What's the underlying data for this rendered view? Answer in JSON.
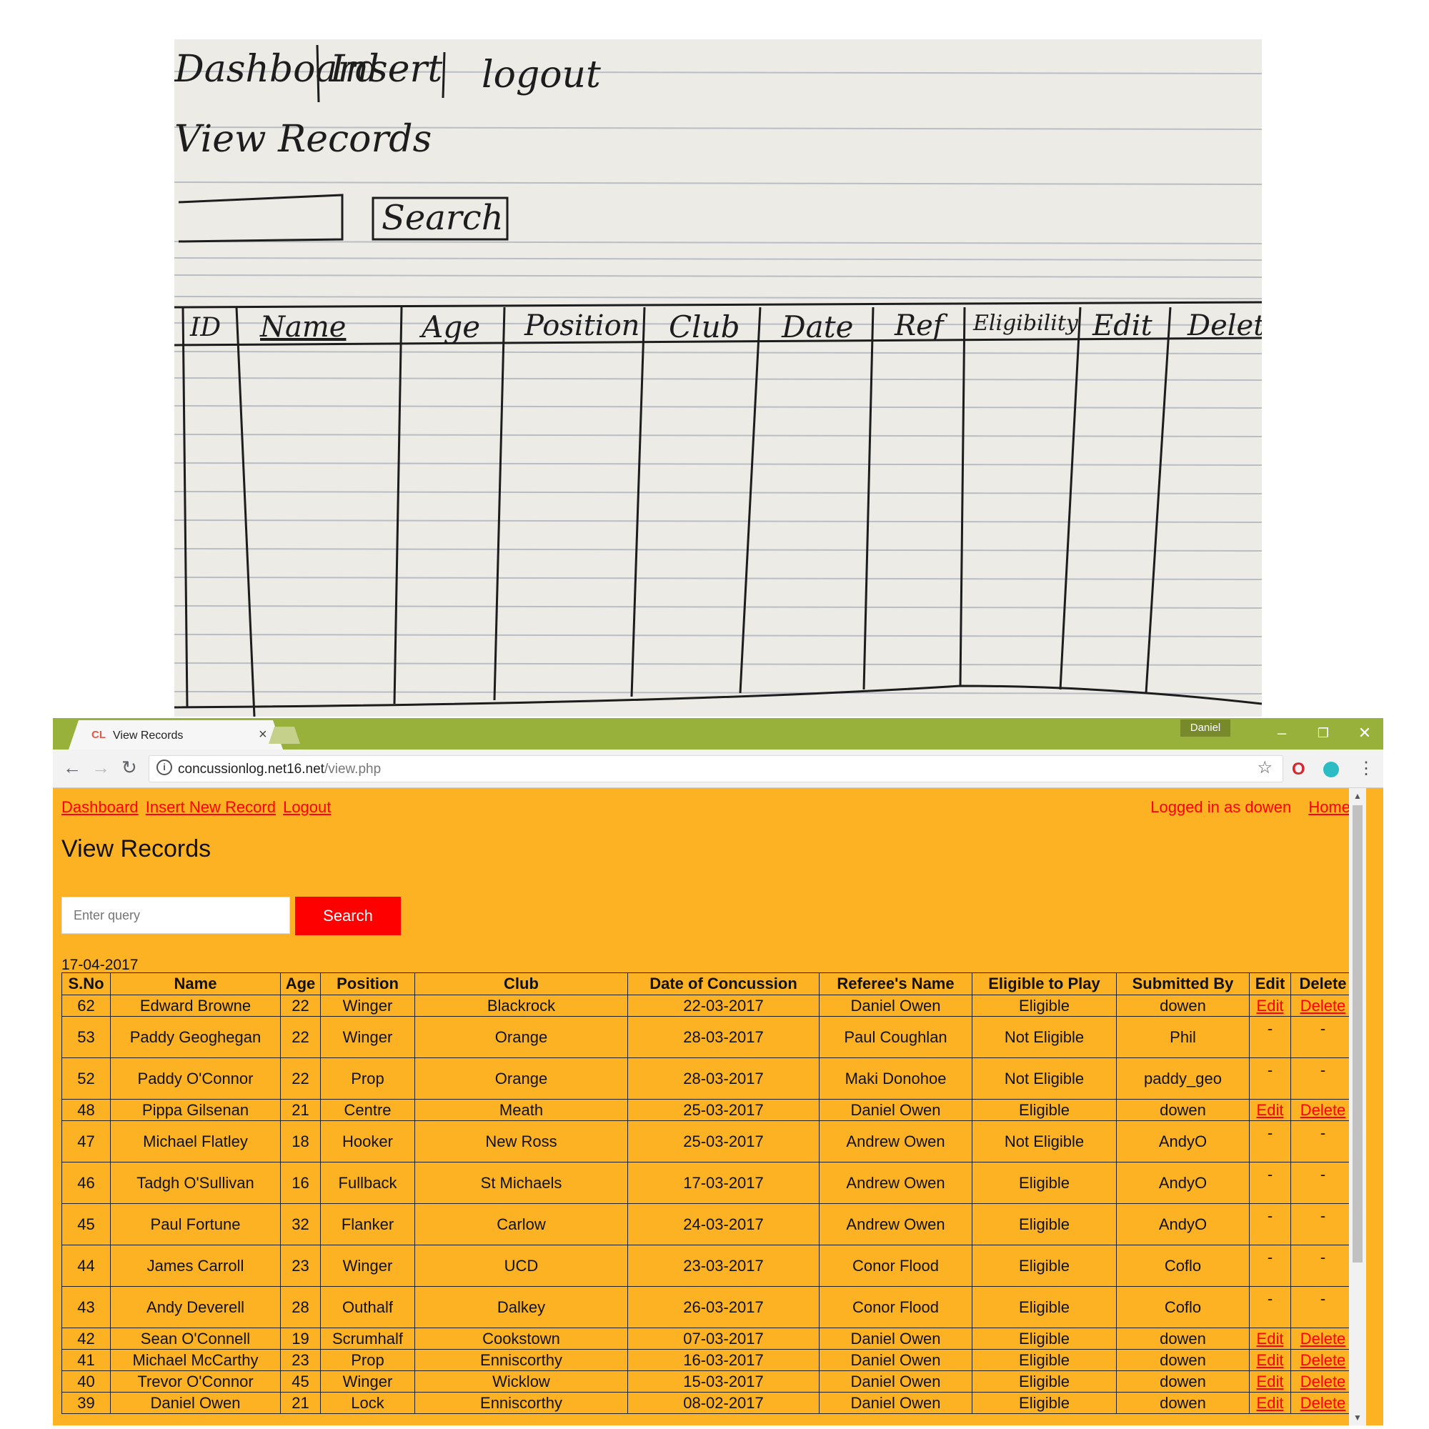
{
  "sketch": {
    "nav": [
      "Dashboard",
      "Insert",
      "logout"
    ],
    "title": "View Records",
    "search_label": "Search",
    "columns": [
      "ID",
      "Name",
      "Age",
      "Position",
      "Club",
      "Date",
      "Ref",
      "Eligibility",
      "Edit",
      "Delete"
    ]
  },
  "browser": {
    "tab_title": "View Records",
    "favicon": "CL",
    "user_chip": "Daniel",
    "url_domain": "concussionlog.net16.net",
    "url_path": "/view.php",
    "icons": [
      "back-arrow-icon",
      "forward-arrow-icon",
      "reload-icon",
      "info-icon",
      "star-icon",
      "extension-icon",
      "menu-dots-icon"
    ]
  },
  "page": {
    "nav": {
      "dashboard": "Dashboard",
      "insert": "Insert New Record",
      "logout": "Logout"
    },
    "logged_in": "Logged in as dowen",
    "home": "Home",
    "title": "View Records",
    "search_placeholder": "Enter query",
    "search_button": "Search",
    "date": "17-04-2017",
    "link_color": "#ff0000",
    "background_color": "#fdb223"
  },
  "table": {
    "headers": [
      "S.No",
      "Name",
      "Age",
      "Position",
      "Club",
      "Date of Concussion",
      "Referee's Name",
      "Eligible to Play",
      "Submitted By",
      "Edit",
      "Delete"
    ],
    "rows": [
      {
        "sno": "62",
        "name": "Edward Browne",
        "age": "22",
        "position": "Winger",
        "club": "Blackrock",
        "date": "22-03-2017",
        "referee": "Daniel Owen",
        "eligible": "Eligible",
        "submitted_by": "dowen",
        "edit": "Edit",
        "delete": "Delete",
        "editable": true
      },
      {
        "sno": "53",
        "name": "Paddy Geoghegan",
        "age": "22",
        "position": "Winger",
        "club": "Orange",
        "date": "28-03-2017",
        "referee": "Paul Coughlan",
        "eligible": "Not Eligible",
        "submitted_by": "Phil",
        "edit": "-",
        "delete": "-",
        "editable": false
      },
      {
        "sno": "52",
        "name": "Paddy O'Connor",
        "age": "22",
        "position": "Prop",
        "club": "Orange",
        "date": "28-03-2017",
        "referee": "Maki Donohoe",
        "eligible": "Not Eligible",
        "submitted_by": "paddy_geo",
        "edit": "-",
        "delete": "-",
        "editable": false
      },
      {
        "sno": "48",
        "name": "Pippa Gilsenan",
        "age": "21",
        "position": "Centre",
        "club": "Meath",
        "date": "25-03-2017",
        "referee": "Daniel Owen",
        "eligible": "Eligible",
        "submitted_by": "dowen",
        "edit": "Edit",
        "delete": "Delete",
        "editable": true
      },
      {
        "sno": "47",
        "name": "Michael Flatley",
        "age": "18",
        "position": "Hooker",
        "club": "New Ross",
        "date": "25-03-2017",
        "referee": "Andrew Owen",
        "eligible": "Not Eligible",
        "submitted_by": "AndyO",
        "edit": "-",
        "delete": "-",
        "editable": false
      },
      {
        "sno": "46",
        "name": "Tadgh O'Sullivan",
        "age": "16",
        "position": "Fullback",
        "club": "St Michaels",
        "date": "17-03-2017",
        "referee": "Andrew Owen",
        "eligible": "Eligible",
        "submitted_by": "AndyO",
        "edit": "-",
        "delete": "-",
        "editable": false
      },
      {
        "sno": "45",
        "name": "Paul Fortune",
        "age": "32",
        "position": "Flanker",
        "club": "Carlow",
        "date": "24-03-2017",
        "referee": "Andrew Owen",
        "eligible": "Eligible",
        "submitted_by": "AndyO",
        "edit": "-",
        "delete": "-",
        "editable": false
      },
      {
        "sno": "44",
        "name": "James Carroll",
        "age": "23",
        "position": "Winger",
        "club": "UCD",
        "date": "23-03-2017",
        "referee": "Conor Flood",
        "eligible": "Eligible",
        "submitted_by": "Coflo",
        "edit": "-",
        "delete": "-",
        "editable": false
      },
      {
        "sno": "43",
        "name": "Andy Deverell",
        "age": "28",
        "position": "Outhalf",
        "club": "Dalkey",
        "date": "26-03-2017",
        "referee": "Conor Flood",
        "eligible": "Eligible",
        "submitted_by": "Coflo",
        "edit": "-",
        "delete": "-",
        "editable": false
      },
      {
        "sno": "42",
        "name": "Sean O'Connell",
        "age": "19",
        "position": "Scrumhalf",
        "club": "Cookstown",
        "date": "07-03-2017",
        "referee": "Daniel Owen",
        "eligible": "Eligible",
        "submitted_by": "dowen",
        "edit": "Edit",
        "delete": "Delete",
        "editable": true
      },
      {
        "sno": "41",
        "name": "Michael McCarthy",
        "age": "23",
        "position": "Prop",
        "club": "Enniscorthy",
        "date": "16-03-2017",
        "referee": "Daniel Owen",
        "eligible": "Eligible",
        "submitted_by": "dowen",
        "edit": "Edit",
        "delete": "Delete",
        "editable": true
      },
      {
        "sno": "40",
        "name": "Trevor O'Connor",
        "age": "45",
        "position": "Winger",
        "club": "Wicklow",
        "date": "15-03-2017",
        "referee": "Daniel Owen",
        "eligible": "Eligible",
        "submitted_by": "dowen",
        "edit": "Edit",
        "delete": "Delete",
        "editable": true
      },
      {
        "sno": "39",
        "name": "Daniel Owen",
        "age": "21",
        "position": "Lock",
        "club": "Enniscorthy",
        "date": "08-02-2017",
        "referee": "Daniel Owen",
        "eligible": "Eligible",
        "submitted_by": "dowen",
        "edit": "Edit",
        "delete": "Delete",
        "editable": true
      }
    ]
  }
}
